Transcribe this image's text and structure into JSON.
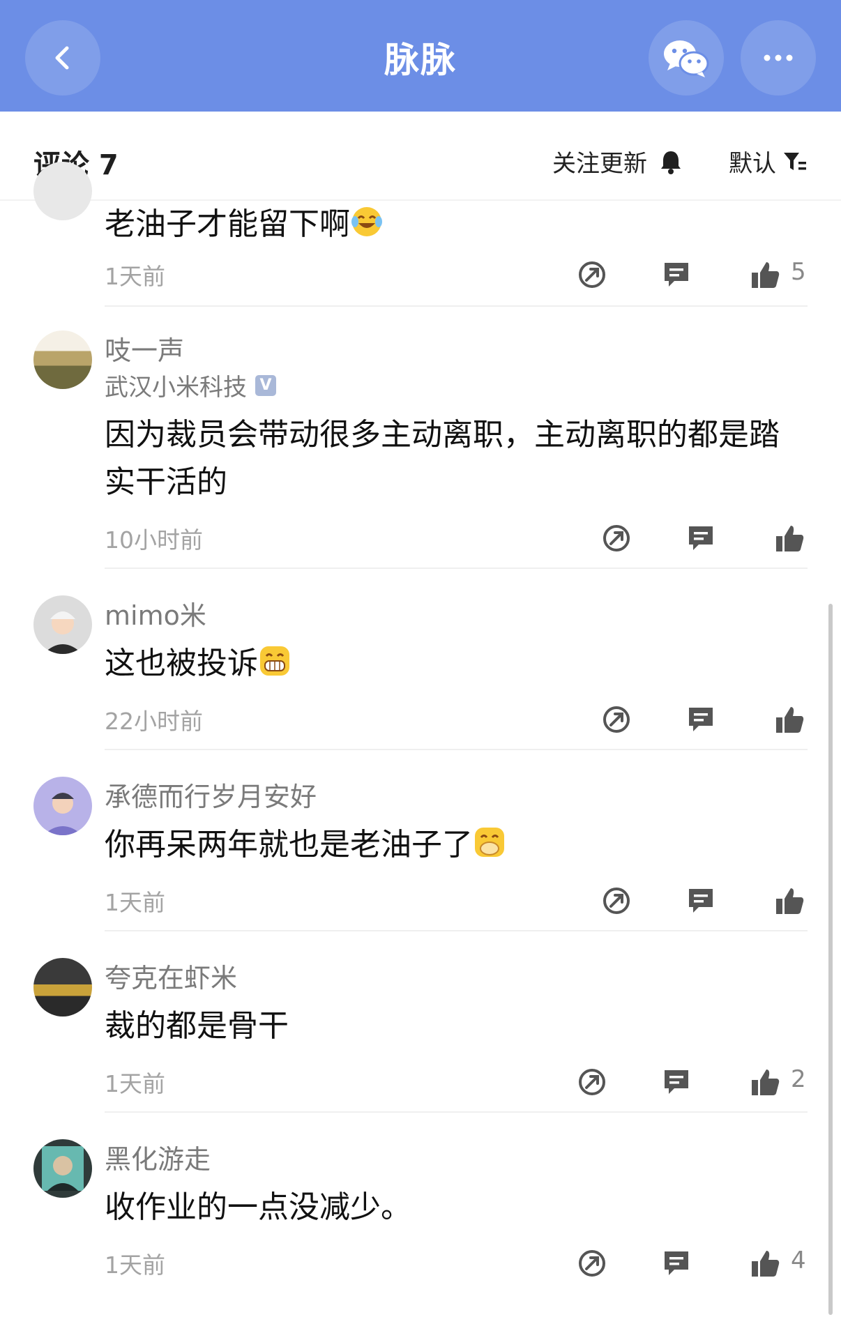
{
  "app": {
    "title": "脉脉"
  },
  "icons": {
    "back": "back-arrow-icon",
    "share": "wechat-icon",
    "more": "more-dots-icon"
  },
  "colors": {
    "header_bg": "#6c8ee6",
    "text_secondary": "#7a7a7a",
    "time_text": "#a3a3a3"
  },
  "subheader": {
    "title": "评论 7",
    "follow_label": "关注更新",
    "sort_label": "默认"
  },
  "comments": [
    {
      "text": "老油子才能留下啊",
      "time": "1天前",
      "likes": "5",
      "emoji": "laughing-tears-emoji"
    },
    {
      "name": "吱一声",
      "company": "武汉小米科技",
      "verified_badge": "V",
      "text": "因为裁员会带动很多主动离职，主动离职的都是踏实干活的",
      "time": "10小时前",
      "likes": ""
    },
    {
      "name": "mimo米",
      "text": "这也被投诉",
      "time": "22小时前",
      "likes": "",
      "emoji": "grin-emoji"
    },
    {
      "name": "承德而行岁月安好",
      "text": "你再呆两年就也是老油子了",
      "time": "1天前",
      "likes": "",
      "emoji": "cover-mouth-emoji"
    },
    {
      "name": "夸克在虾米",
      "text": "裁的都是骨干",
      "time": "1天前",
      "likes": "2"
    },
    {
      "name": "黑化游走",
      "text": "收作业的一点没减少。",
      "time": "1天前",
      "likes": "4"
    }
  ]
}
